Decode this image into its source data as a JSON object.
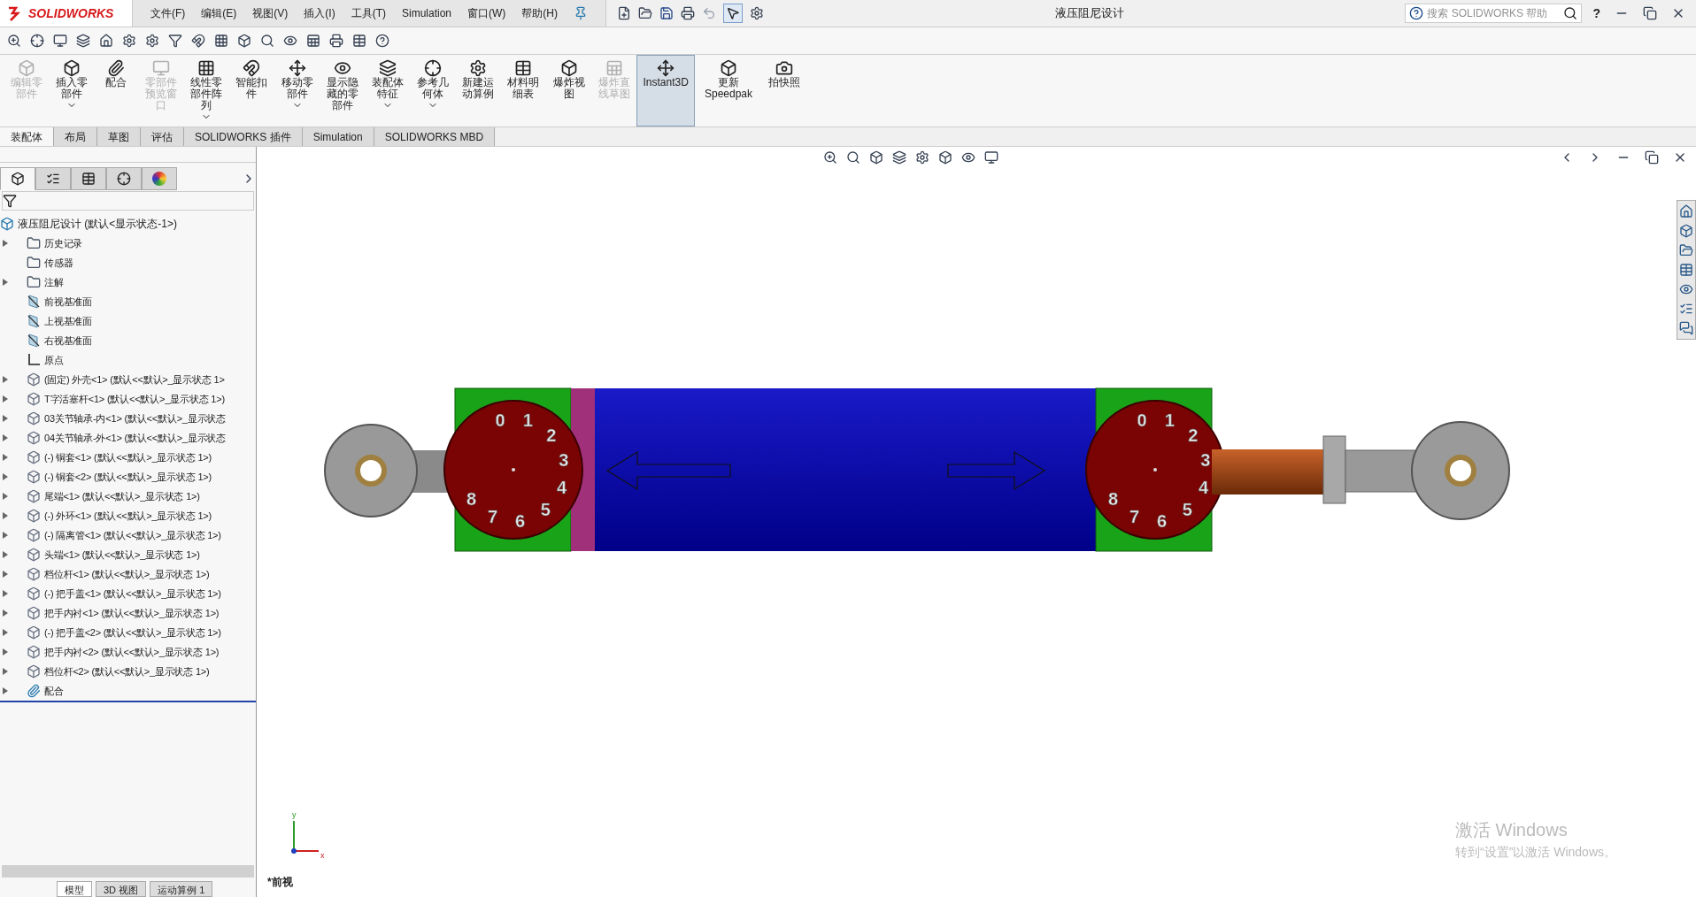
{
  "app": {
    "logo": "SOLIDWORKS"
  },
  "menu": [
    "文件(F)",
    "编辑(E)",
    "视图(V)",
    "插入(I)",
    "工具(T)",
    "Simulation",
    "窗口(W)",
    "帮助(H)"
  ],
  "window": {
    "title": "液压阻尼设计"
  },
  "search": {
    "placeholder": "搜索 SOLIDWORKS 帮助"
  },
  "help_menu": "?",
  "commands": [
    {
      "label": "编辑零部件",
      "disabled": true,
      "dropdown": false,
      "selected": false
    },
    {
      "label": "插入零部件",
      "disabled": false,
      "dropdown": true,
      "selected": false
    },
    {
      "label": "配合",
      "disabled": false,
      "dropdown": false,
      "selected": false
    },
    {
      "label": "零部件预览窗口",
      "disabled": true,
      "dropdown": false,
      "selected": false
    },
    {
      "label": "线性零部件阵列",
      "disabled": false,
      "dropdown": true,
      "selected": false
    },
    {
      "label": "智能扣件",
      "disabled": false,
      "dropdown": false,
      "selected": false
    },
    {
      "label": "移动零部件",
      "disabled": false,
      "dropdown": true,
      "selected": false
    },
    {
      "label": "显示隐藏的零部件",
      "disabled": false,
      "dropdown": false,
      "selected": false
    },
    {
      "label": "装配体特征",
      "disabled": false,
      "dropdown": true,
      "selected": false
    },
    {
      "label": "参考几何体",
      "disabled": false,
      "dropdown": true,
      "selected": false
    },
    {
      "label": "新建运动算例",
      "disabled": false,
      "dropdown": false,
      "selected": false
    },
    {
      "label": "材料明细表",
      "disabled": false,
      "dropdown": false,
      "selected": false
    },
    {
      "label": "爆炸视图",
      "disabled": false,
      "dropdown": false,
      "selected": false
    },
    {
      "label": "爆炸直线草图",
      "disabled": true,
      "dropdown": false,
      "selected": false
    },
    {
      "label": "Instant3D",
      "disabled": false,
      "dropdown": false,
      "selected": true
    },
    {
      "label": "更新Speedpak",
      "disabled": false,
      "dropdown": false,
      "selected": false
    },
    {
      "label": "拍快照",
      "disabled": false,
      "dropdown": false,
      "selected": false
    }
  ],
  "tabs": [
    {
      "label": "装配体",
      "selected": true
    },
    {
      "label": "布局",
      "selected": false
    },
    {
      "label": "草图",
      "selected": false
    },
    {
      "label": "评估",
      "selected": false
    },
    {
      "label": "SOLIDWORKS 插件",
      "selected": false
    },
    {
      "label": "Simulation",
      "selected": false
    },
    {
      "label": "SOLIDWORKS MBD",
      "selected": false
    }
  ],
  "panel_tabs": [
    {
      "kind": "tree",
      "selected": true
    },
    {
      "kind": "properties",
      "selected": false
    },
    {
      "kind": "config",
      "selected": false
    },
    {
      "kind": "dimxpert",
      "selected": false
    },
    {
      "kind": "display",
      "selected": false
    }
  ],
  "tree": {
    "root": "液压阻尼设计  (默认<显示状态-1>)",
    "items": [
      {
        "kind": "history",
        "label": "历史记录",
        "expandable": true
      },
      {
        "kind": "sensor",
        "label": "传感器",
        "expandable": false
      },
      {
        "kind": "annotation",
        "label": "注解",
        "expandable": true
      },
      {
        "kind": "plane",
        "label": "前视基准面",
        "expandable": false
      },
      {
        "kind": "plane",
        "label": "上视基准面",
        "expandable": false
      },
      {
        "kind": "plane",
        "label": "右视基准面",
        "expandable": false
      },
      {
        "kind": "origin",
        "label": "原点",
        "expandable": false
      },
      {
        "kind": "part",
        "label": "(固定) 外壳<1> (默认<<默认>_显示状态 1>",
        "expandable": true
      },
      {
        "kind": "part",
        "label": "T字活塞杆<1> (默认<<默认>_显示状态 1>)",
        "expandable": true
      },
      {
        "kind": "part",
        "label": "03关节轴承-内<1> (默认<<默认>_显示状态",
        "expandable": true
      },
      {
        "kind": "part",
        "label": "04关节轴承-外<1> (默认<<默认>_显示状态",
        "expandable": true
      },
      {
        "kind": "part",
        "label": "(-) 铜套<1> (默认<<默认>_显示状态 1>)",
        "expandable": true
      },
      {
        "kind": "part",
        "label": "(-) 铜套<2> (默认<<默认>_显示状态 1>)",
        "expandable": true
      },
      {
        "kind": "part",
        "label": "尾端<1> (默认<<默认>_显示状态 1>)",
        "expandable": true
      },
      {
        "kind": "part",
        "label": "(-) 外环<1> (默认<<默认>_显示状态 1>)",
        "expandable": true
      },
      {
        "kind": "part",
        "label": "(-) 隔离管<1> (默认<<默认>_显示状态 1>)",
        "expandable": true
      },
      {
        "kind": "part",
        "label": "头端<1> (默认<<默认>_显示状态 1>)",
        "expandable": true
      },
      {
        "kind": "part",
        "label": "档位杆<1> (默认<<默认>_显示状态 1>)",
        "expandable": true
      },
      {
        "kind": "part",
        "label": "(-) 把手盖<1> (默认<<默认>_显示状态 1>)",
        "expandable": true
      },
      {
        "kind": "part",
        "label": "把手内衬<1> (默认<<默认>_显示状态 1>)",
        "expandable": true
      },
      {
        "kind": "part",
        "label": "(-) 把手盖<2> (默认<<默认>_显示状态 1>)",
        "expandable": true
      },
      {
        "kind": "part",
        "label": "把手内衬<2> (默认<<默认>_显示状态 1>)",
        "expandable": true
      },
      {
        "kind": "part",
        "label": "档位杆<2> (默认<<默认>_显示状态 1>)",
        "expandable": true
      },
      {
        "kind": "mates",
        "label": "配合",
        "expandable": true
      }
    ]
  },
  "bottom_tabs": [
    {
      "label": "模型",
      "selected": true
    },
    {
      "label": "3D 视图",
      "selected": false
    },
    {
      "label": "运动算例 1",
      "selected": false
    }
  ],
  "viewport": {
    "view_name": "*前视",
    "triad": [
      "y",
      "x"
    ],
    "dials": [
      {
        "digits": [
          "0",
          "1",
          "2",
          "3",
          "4",
          "5",
          "6",
          "7",
          "8"
        ]
      },
      {
        "digits": [
          "0",
          "1",
          "2",
          "3",
          "4",
          "5",
          "6",
          "7",
          "8"
        ]
      }
    ]
  },
  "activation": {
    "title": "激活 Windows",
    "hint": "转到“设置”以激活 Windows。"
  }
}
